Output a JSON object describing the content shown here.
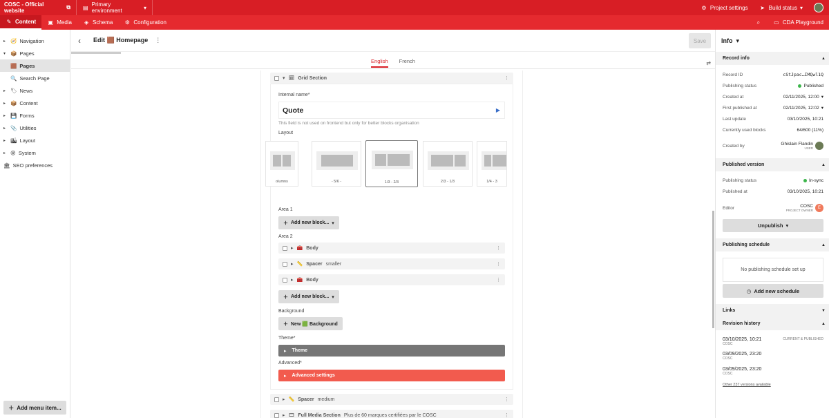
{
  "topbar": {
    "brand": "COSC - Official website",
    "env": "Primary environment",
    "project_settings": "Project settings",
    "build_status": "Build status"
  },
  "subbar": {
    "tabs": [
      "Content",
      "Media",
      "Schema",
      "Configuration"
    ],
    "cda": "CDA Playground"
  },
  "sidebar": {
    "items": [
      {
        "label": "Navigation"
      },
      {
        "label": "Pages"
      },
      {
        "label": "Pages"
      },
      {
        "label": "Search Page"
      },
      {
        "label": "News"
      },
      {
        "label": "Content"
      },
      {
        "label": "Forms"
      },
      {
        "label": "Utilities"
      },
      {
        "label": "Layout"
      },
      {
        "label": "System"
      },
      {
        "label": "SEO preferences"
      }
    ],
    "add_menu": "Add menu item..."
  },
  "editor": {
    "title": "Edit 🟫 Homepage",
    "save": "Save",
    "languages": [
      "English",
      "French"
    ],
    "block_title": "Grid Section",
    "internal_name_label": "Internal name*",
    "internal_name_value": "Quote",
    "internal_name_hint": "This field is not used on frontend but only for better blocks organisation",
    "layout_label": "Layout",
    "layouts": [
      "olumns",
      "- 5/6 -",
      "1/3 - 2/3",
      "2/3 - 1/3",
      "1/4 - 3"
    ],
    "area1": "Area 1",
    "area2": "Area 2",
    "add_block": "Add new block...",
    "area2_rows": [
      {
        "name": "Body",
        "note": ""
      },
      {
        "name": "Spacer",
        "note": "smaller"
      },
      {
        "name": "Body",
        "note": ""
      }
    ],
    "background_label": "Background",
    "new_background": "New 🟩 Background",
    "theme_label": "Theme*",
    "theme_bar": "Theme",
    "advanced_label": "Advanced*",
    "advanced_bar": "Advanced settings",
    "after_rows": [
      {
        "name": "Spacer",
        "note": "medium"
      },
      {
        "name": "Full Media Section",
        "note": "Plus de 60 marques certifiées par le COSC"
      }
    ]
  },
  "info": {
    "title": "Info",
    "record_info": "Record info",
    "record_id_label": "Record ID",
    "record_id": "cStJpac…IMQwl1Q",
    "publishing_status_label": "Publishing status",
    "publishing_status": "Published",
    "created_label": "Created at",
    "created": "02/11/2025, 12:00",
    "first_pub_label": "First published at",
    "first_pub": "02/11/2025, 12:02",
    "last_update_label": "Last update",
    "last_update": "03/10/2025, 10:21",
    "blocks_label": "Currently used blocks",
    "blocks": "64/600 (11%)",
    "created_by_label": "Created by",
    "created_by": "Ghislain Flandin",
    "created_by_role": "USER",
    "published_version": "Published version",
    "pv_status_label": "Publishing status",
    "pv_status": "In-sync",
    "pv_at_label": "Published at",
    "pv_at": "03/10/2025, 10:21",
    "editor_label": "Editor",
    "editor": "COSC",
    "editor_role": "PROJECT OWNER",
    "unpublish": "Unpublish",
    "schedule": "Publishing schedule",
    "no_schedule": "No publishing schedule set up",
    "add_schedule": "Add new schedule",
    "links": "Links",
    "revision_history": "Revision history",
    "revisions": [
      {
        "date": "03/10/2025, 10:21",
        "by": "COSC",
        "tag": "CURRENT & PUBLISHED"
      },
      {
        "date": "03/09/2025, 23:20",
        "by": "COSC",
        "tag": ""
      },
      {
        "date": "03/09/2025, 23:20",
        "by": "COSC",
        "tag": ""
      }
    ],
    "other_versions": "Other 237 versions available"
  },
  "colors": {
    "brand": "#d81e25",
    "advanced": "#f25b4e",
    "theme": "#767676"
  }
}
